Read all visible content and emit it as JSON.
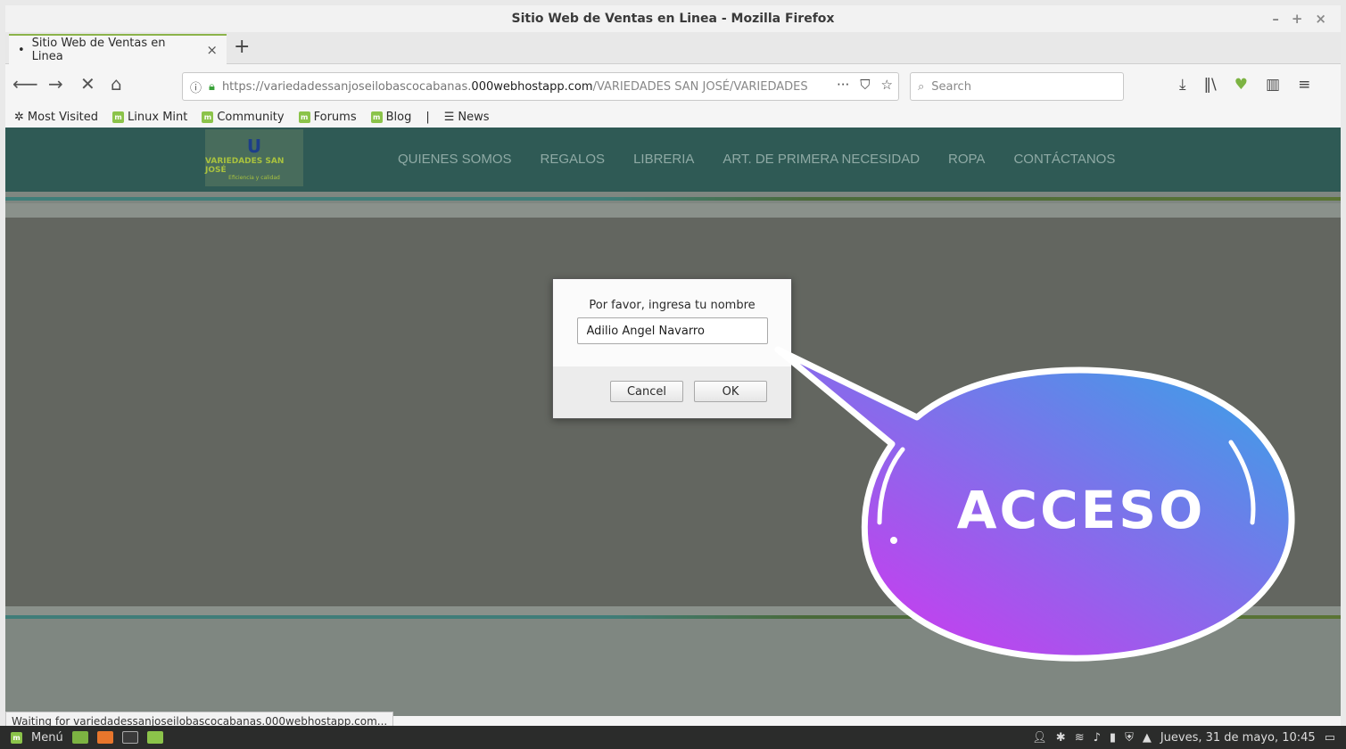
{
  "window": {
    "title": "Sitio Web de Ventas en Linea - Mozilla Firefox"
  },
  "tabs": [
    {
      "label": "Sitio Web de Ventas en Linea"
    }
  ],
  "url": {
    "host": "https://variedadessanjoseilobascocabanas.",
    "domain": "000webhostapp.com",
    "path": "/VARIEDADES SAN JOSÉ/VARIEDADES"
  },
  "search": {
    "placeholder": "Search"
  },
  "bookmarks": [
    {
      "label": "Most Visited"
    },
    {
      "label": "Linux Mint"
    },
    {
      "label": "Community"
    },
    {
      "label": "Forums"
    },
    {
      "label": "Blog"
    },
    {
      "label": "News"
    }
  ],
  "site": {
    "logo": {
      "name": "VARIEDADES SAN JOSÉ",
      "tagline": "Eficiencia y calidad"
    },
    "menu": [
      {
        "label": "QUIENES SOMOS"
      },
      {
        "label": "REGALOS"
      },
      {
        "label": "LIBRERIA"
      },
      {
        "label": "ART. DE PRIMERA NECESIDAD"
      },
      {
        "label": "ROPA"
      },
      {
        "label": "CONTÁCTANOS"
      }
    ]
  },
  "dialog": {
    "prompt": "Por favor, ingresa tu nombre",
    "value": "Adilio Angel Navarro",
    "cancel_label": "Cancel",
    "ok_label": "OK"
  },
  "status": {
    "text": "Waiting for variedadessanjoseilobascocabanas.000webhostapp.com..."
  },
  "taskbar": {
    "menu_label": "Menú",
    "clock": "Jueves, 31 de mayo, 10:45"
  },
  "overlay": {
    "label": "ACCESO"
  },
  "colors": {
    "nav_bg": "#2f5a55",
    "overlay_start": "#e02cf0",
    "overlay_end": "#2fa9e6"
  }
}
